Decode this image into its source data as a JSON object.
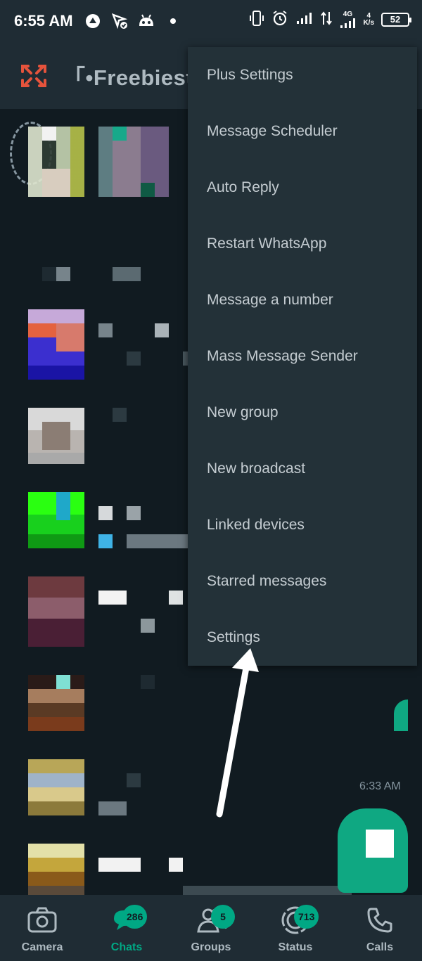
{
  "status_bar": {
    "time": "6:55 AM",
    "network_type": "4G",
    "speed_value": "4",
    "speed_unit": "K/s",
    "battery": "52"
  },
  "header": {
    "title": "「•Freebiest.",
    "logo_color": "#e5533c"
  },
  "menu": {
    "items": [
      {
        "label": "Plus Settings"
      },
      {
        "label": "Message Scheduler"
      },
      {
        "label": "Auto Reply"
      },
      {
        "label": "Restart WhatsApp"
      },
      {
        "label": "Message a number"
      },
      {
        "label": "Mass Message Sender"
      },
      {
        "label": "New group"
      },
      {
        "label": "New broadcast"
      },
      {
        "label": "Linked devices"
      },
      {
        "label": "Starred messages"
      },
      {
        "label": "Settings"
      }
    ]
  },
  "chat_list": {
    "visible_time": "6:33 AM"
  },
  "bottom_nav": {
    "tabs": [
      {
        "label": "Camera",
        "icon": "camera-icon",
        "badge": ""
      },
      {
        "label": "Chats",
        "icon": "chats-icon",
        "badge": "286"
      },
      {
        "label": "Groups",
        "icon": "groups-icon",
        "badge": "5"
      },
      {
        "label": "Status",
        "icon": "status-icon",
        "badge": "713"
      },
      {
        "label": "Calls",
        "icon": "calls-icon",
        "badge": ""
      }
    ],
    "active_tab": "Chats"
  },
  "colors": {
    "accent": "#00a884",
    "background": "#111b21",
    "bar": "#1f2c34",
    "menu": "#233138"
  }
}
